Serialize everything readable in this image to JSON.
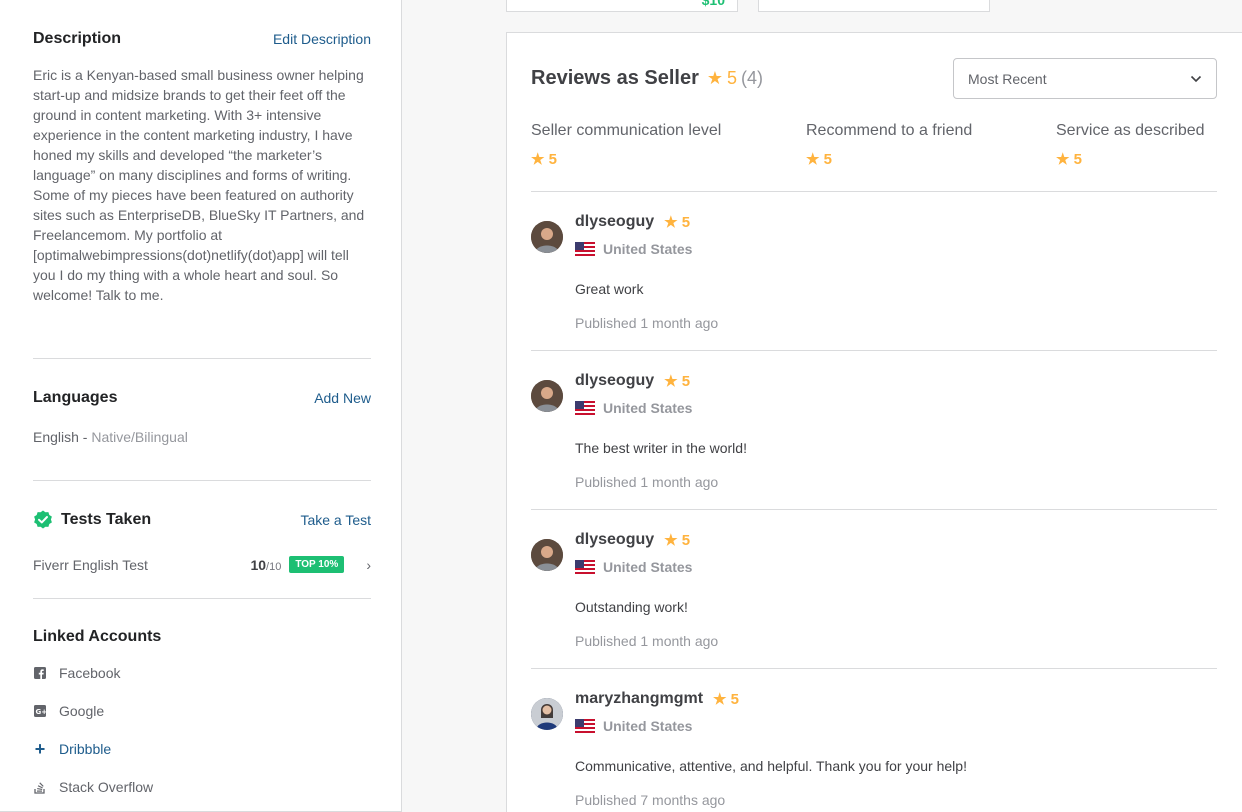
{
  "description": {
    "title": "Description",
    "edit_link": "Edit Description",
    "text": "Eric is a Kenyan-based small business owner helping start-up and midsize brands to get their feet off the ground in content marketing. With 3+ intensive experience in the content marketing industry, I have honed my skills and developed “the marketer’s language” on many disciplines and forms of writing. Some of my pieces have been featured on authority sites such as EnterpriseDB, BlueSky IT Partners, and Freelancemom. My portfolio at [optimalwebimpressions(dot)netlify(dot)app] will tell you I do my thing with a whole heart and soul. So welcome! Talk to me."
  },
  "languages": {
    "title": "Languages",
    "add_link": "Add New",
    "items": [
      {
        "name": "English - ",
        "level": "Native/Bilingual"
      }
    ]
  },
  "tests": {
    "title": "Tests Taken",
    "take_link": "Take a Test",
    "items": [
      {
        "name": "Fiverr English Test",
        "score": "10",
        "out_of": "/10",
        "badge": "TOP 10%"
      }
    ]
  },
  "linked_accounts": {
    "title": "Linked Accounts",
    "items": [
      {
        "label": "Facebook",
        "icon": "facebook-icon"
      },
      {
        "label": "Google",
        "icon": "google-plus-icon"
      },
      {
        "label": "Dribbble",
        "icon": "plus-icon"
      },
      {
        "label": "Stack Overflow",
        "icon": "stackoverflow-icon"
      }
    ]
  },
  "top_stub": {
    "price": "$10"
  },
  "reviews": {
    "title": "Reviews as Seller",
    "score": "5",
    "count": "(4)",
    "sort": {
      "selected": "Most Recent"
    },
    "metrics": [
      {
        "label": "Seller communication level",
        "value": "5"
      },
      {
        "label": "Recommend to a friend",
        "value": "5"
      },
      {
        "label": "Service as described",
        "value": "5"
      }
    ],
    "items": [
      {
        "user": "dlyseoguy",
        "rating": "5",
        "country": "United States",
        "text": "Great work",
        "date": "Published 1 month ago"
      },
      {
        "user": "dlyseoguy",
        "rating": "5",
        "country": "United States",
        "text": "The best writer in the world!",
        "date": "Published 1 month ago"
      },
      {
        "user": "dlyseoguy",
        "rating": "5",
        "country": "United States",
        "text": "Outstanding work!",
        "date": "Published 1 month ago"
      },
      {
        "user": "maryzhangmgmt",
        "rating": "5",
        "country": "United States",
        "text": "Communicative, attentive, and helpful. Thank you for your help!",
        "date": "Published 7 months ago"
      }
    ]
  },
  "colors": {
    "accent_green": "#1dbf73",
    "star": "#ffb33e",
    "link": "#1e5c8c"
  }
}
